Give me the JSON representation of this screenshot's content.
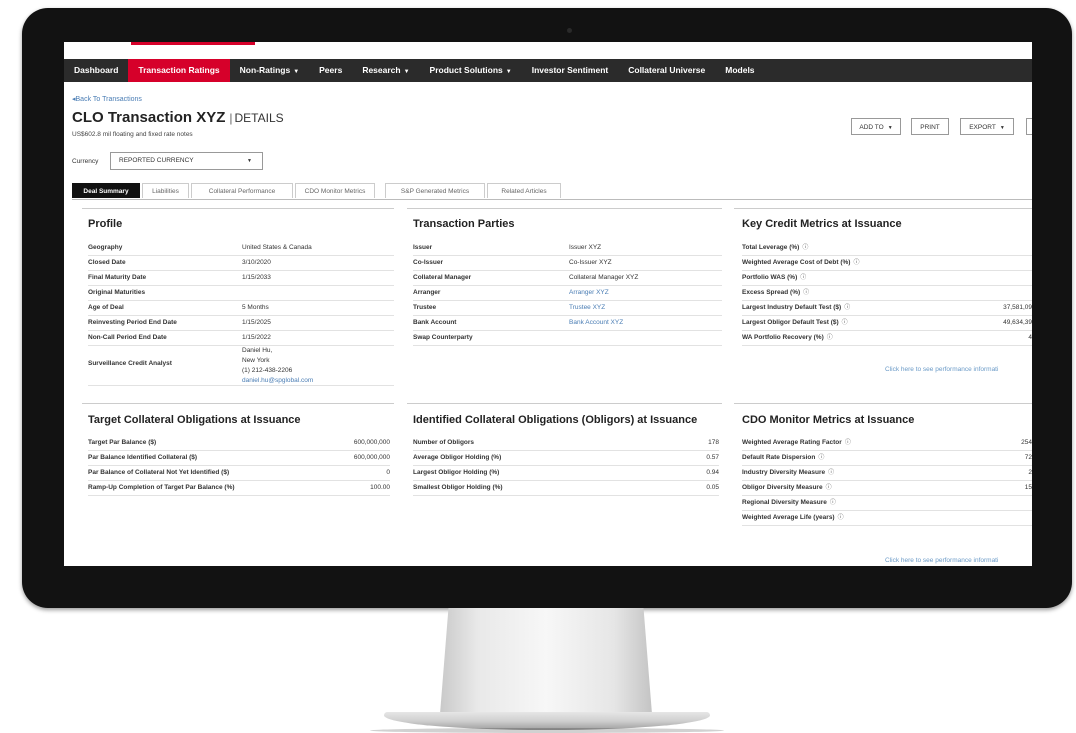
{
  "nav": [
    {
      "label": "Dashboard",
      "active": false,
      "dropdown": false
    },
    {
      "label": "Transaction Ratings",
      "active": true,
      "dropdown": false
    },
    {
      "label": "Non-Ratings",
      "active": false,
      "dropdown": true
    },
    {
      "label": "Peers",
      "active": false,
      "dropdown": false
    },
    {
      "label": "Research",
      "active": false,
      "dropdown": true
    },
    {
      "label": "Product Solutions",
      "active": false,
      "dropdown": true
    },
    {
      "label": "Investor Sentiment",
      "active": false,
      "dropdown": false
    },
    {
      "label": "Collateral Universe",
      "active": false,
      "dropdown": false
    },
    {
      "label": "Models",
      "active": false,
      "dropdown": false
    }
  ],
  "back_link": "Back To Transactions",
  "title": {
    "main": "CLO Transaction XYZ",
    "separator": "|",
    "details": "DETAILS"
  },
  "subtitle": "US$602.8 mil floating and fixed rate notes",
  "toolbar": {
    "add_to": "ADD TO",
    "print": "PRINT",
    "export": "EXPORT"
  },
  "currency": {
    "label": "Currency",
    "selected": "REPORTED CURRENCY"
  },
  "tabs": [
    "Deal Summary",
    "Liabilities",
    "Collateral Performance",
    "CDO Monitor Metrics",
    "S&P Generated Metrics",
    "Related Articles"
  ],
  "profile": {
    "title": "Profile",
    "rows": [
      {
        "key": "Geography",
        "value": "United States & Canada"
      },
      {
        "key": "Closed Date",
        "value": "3/10/2020"
      },
      {
        "key": "Final Maturity Date",
        "value": "1/15/2033"
      },
      {
        "key": "Original Maturities",
        "value": ""
      },
      {
        "key": "Age of Deal",
        "value": "5 Months"
      },
      {
        "key": "Reinvesting Period End Date",
        "value": "1/15/2025"
      },
      {
        "key": "Non-Call Period End Date",
        "value": "1/15/2022"
      }
    ],
    "analyst": {
      "key": "Surveillance Credit Analyst",
      "name": "Daniel Hu,",
      "location": "New York",
      "phone": "(1) 212-438-2206",
      "email": "daniel.hu@spglobal.com"
    }
  },
  "transaction_parties": {
    "title": "Transaction Parties",
    "rows": [
      {
        "key": "Issuer",
        "value": "Issuer XYZ",
        "link": false
      },
      {
        "key": "Co-Issuer",
        "value": "Co-Issuer XYZ",
        "link": false
      },
      {
        "key": "Collateral Manager",
        "value": "Collateral Manager XYZ",
        "link": false
      },
      {
        "key": "Arranger",
        "value": "Arranger XYZ",
        "link": true
      },
      {
        "key": "Trustee",
        "value": "Trustee XYZ",
        "link": true
      },
      {
        "key": "Bank Account",
        "value": "Bank Account XYZ",
        "link": true
      },
      {
        "key": "Swap Counterparty",
        "value": "",
        "link": false
      }
    ]
  },
  "key_credit_metrics": {
    "title": "Key Credit Metrics at Issuance",
    "rows": [
      {
        "key": "Total Leverage (%)",
        "value": ""
      },
      {
        "key": "Weighted Average Cost of Debt (%)",
        "value": ""
      },
      {
        "key": "Portfolio WAS (%)",
        "value": ""
      },
      {
        "key": "Excess Spread (%)",
        "value": ""
      },
      {
        "key": "Largest Industry Default Test ($)",
        "value": "37,581,09"
      },
      {
        "key": "Largest Obligor Default Test ($)",
        "value": "49,634,39"
      },
      {
        "key": "WA Portfolio Recovery (%)",
        "value": "4"
      }
    ],
    "footer_link": "Click here to see performance informati"
  },
  "target_collateral": {
    "title": "Target Collateral Obligations at Issuance",
    "rows": [
      {
        "key": "Target Par Balance ($)",
        "value": "600,000,000"
      },
      {
        "key": "Par Balance Identified Collateral ($)",
        "value": "600,000,000"
      },
      {
        "key": "Par Balance of Collateral Not Yet Identified ($)",
        "value": "0"
      },
      {
        "key": "Ramp-Up Completion of Target Par Balance (%)",
        "value": "100.00"
      }
    ]
  },
  "identified_collateral": {
    "title": "Identified Collateral Obligations (Obligors) at Issuance",
    "rows": [
      {
        "key": "Number of Obligors",
        "value": "178"
      },
      {
        "key": "Average Obligor Holding (%)",
        "value": "0.57"
      },
      {
        "key": "Largest Obligor Holding (%)",
        "value": "0.94"
      },
      {
        "key": "Smallest Obligor Holding (%)",
        "value": "0.05"
      }
    ]
  },
  "cdo_monitor": {
    "title": "CDO Monitor Metrics at Issuance",
    "rows": [
      {
        "key": "Weighted Average Rating Factor",
        "value": "254"
      },
      {
        "key": "Default Rate Dispersion",
        "value": "72"
      },
      {
        "key": "Industry Diversity Measure",
        "value": "2"
      },
      {
        "key": "Obligor Diversity Measure",
        "value": "15"
      },
      {
        "key": "Regional Diversity Measure",
        "value": ""
      },
      {
        "key": "Weighted Average Life (years)",
        "value": ""
      }
    ],
    "footer_link": "Click here to see performance informati"
  }
}
